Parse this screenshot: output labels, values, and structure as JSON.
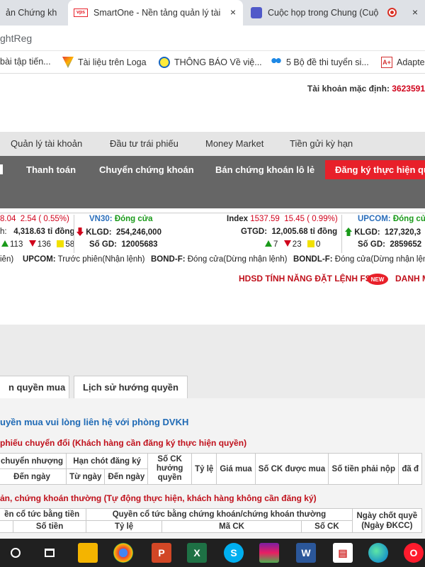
{
  "browser": {
    "tabs": [
      {
        "label": "ản Chứng kh"
      },
      {
        "label": "SmartOne - Nền tảng quản lý tài",
        "close": "×"
      },
      {
        "label": "Cuộc họp trong Chung (Cuộ",
        "close": "×"
      }
    ],
    "address": "ghtReg",
    "bookmarks": [
      {
        "label": "bài tập tiến..."
      },
      {
        "label": "Tài liệu trên Loga"
      },
      {
        "label": "THÔNG BÁO Về việ..."
      },
      {
        "label": "5 Bộ đề thi tuyển si..."
      },
      {
        "label": "Adapte"
      }
    ]
  },
  "account": {
    "label": "Tài khoản mặc định: ",
    "value": "3623591"
  },
  "menu1": [
    "Quản lý tài khoản",
    "Đầu tư trái phiếu",
    "Money Market",
    "Tiền gửi kỳ hạn"
  ],
  "menu2": [
    "Thanh toán",
    "Chuyển chứng khoán",
    "Bán chứng khoán lô lẻ",
    "Đăng ký thực hiện qu"
  ],
  "ticker": {
    "left": {
      "index": "8.04",
      "change": "2.54 ( 0.55%)",
      "value_label": "h:",
      "value": "4,318.63 tỉ đồng",
      "up": "113",
      "down": "136",
      "ref": "58"
    },
    "vn30": {
      "name": "VN30:",
      "status": "Đóng cửa",
      "klgd_label": "KLGD:",
      "klgd": "254,246,000",
      "sogd_label": "Số GD:",
      "sogd": "12005683"
    },
    "index": {
      "label": "Index",
      "value": "1537.59",
      "change": "15.45 ( 0.99%)",
      "gtgd_label": "GTGD:",
      "gtgd": "12,005.68 tỉ đồng",
      "up": "7",
      "down": "23",
      "ref": "0"
    },
    "upcom": {
      "name": "UPCOM:",
      "status": "Đóng cửa",
      "klgd_label": "KLGD:",
      "klgd": "127,320,3",
      "sogd_label": "Số GD:",
      "sogd": "2859652"
    }
  },
  "status_line": {
    "s1": "iên)",
    "s2_label": "UPCOM:",
    "s2": "Trước phiên(Nhận lệnh)",
    "s3_label": "BOND-F:",
    "s3": "Đóng cửa(Dừng nhận lệnh)",
    "s4_label": "BONDL-F:",
    "s4": "Đóng cửa(Dừng nhận lệnh)"
  },
  "hdsd": "HDSD TÍNH NĂNG ĐẶT LỆNH FS",
  "new_badge": "NEW",
  "danh": "DANH M",
  "subtabs": [
    "n quyền mua",
    "Lịch sử hướng quyền"
  ],
  "notice": "uyền mua vui lòng liên hệ với phòng DVKH",
  "section1": "phiếu chuyển đổi (Khách hàng cần đăng ký thực hiện quyền)",
  "table1": {
    "h1": "chuyển nhượng",
    "h2": "Hạn chót đăng ký",
    "h3": "Số CK hưởng quyền",
    "h4": "Tỷ lệ",
    "h5": "Giá mua",
    "h6": "Số CK được mua",
    "h7": "Số tiền phải nộp",
    "h8": "đã đ",
    "s1": "Đến ngày",
    "s2": "Từ ngày",
    "s3": "Đến ngày"
  },
  "section2": "ản, chứng khoán thường (Tự động thực hiện, khách hàng không cần đăng ký)",
  "table2": {
    "h1": "ền cổ tức bằng tiền",
    "h2": "Quyền cổ tức bằng chứng khoán/chứng khoán thường",
    "h3": "Ngày chốt quyề (Ngày ĐKCC)",
    "s1": "Số tiền",
    "s2": "Tỷ lệ",
    "s3": "Mã CK",
    "s4": "Số CK"
  },
  "colors": {
    "accent": "#e8202a",
    "menu_dark": "#666666",
    "link_blue": "#1f6ab5",
    "section_red": "#c0101b"
  }
}
